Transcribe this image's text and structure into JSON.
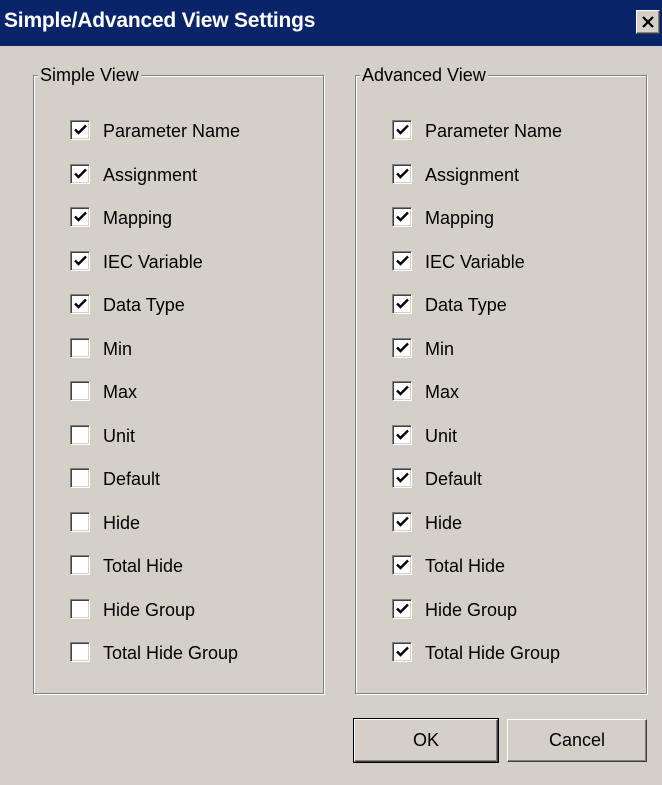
{
  "window": {
    "title": "Simple/Advanced View Settings",
    "close_icon": "close-x-icon"
  },
  "simple_view": {
    "legend": "Simple View",
    "items": [
      {
        "label": "Parameter Name",
        "checked": true
      },
      {
        "label": "Assignment",
        "checked": true
      },
      {
        "label": "Mapping",
        "checked": true
      },
      {
        "label": "IEC Variable",
        "checked": true
      },
      {
        "label": "Data Type",
        "checked": true
      },
      {
        "label": "Min",
        "checked": false
      },
      {
        "label": "Max",
        "checked": false
      },
      {
        "label": "Unit",
        "checked": false
      },
      {
        "label": "Default",
        "checked": false
      },
      {
        "label": "Hide",
        "checked": false
      },
      {
        "label": "Total Hide",
        "checked": false
      },
      {
        "label": "Hide Group",
        "checked": false
      },
      {
        "label": "Total Hide Group",
        "checked": false
      }
    ]
  },
  "advanced_view": {
    "legend": "Advanced View",
    "items": [
      {
        "label": "Parameter Name",
        "checked": true
      },
      {
        "label": "Assignment",
        "checked": true
      },
      {
        "label": "Mapping",
        "checked": true
      },
      {
        "label": "IEC Variable",
        "checked": true
      },
      {
        "label": "Data Type",
        "checked": true
      },
      {
        "label": "Min",
        "checked": true
      },
      {
        "label": "Max",
        "checked": true
      },
      {
        "label": "Unit",
        "checked": true
      },
      {
        "label": "Default",
        "checked": true
      },
      {
        "label": "Hide",
        "checked": true
      },
      {
        "label": "Total Hide",
        "checked": true
      },
      {
        "label": "Hide Group",
        "checked": true
      },
      {
        "label": "Total Hide Group",
        "checked": true
      }
    ]
  },
  "buttons": {
    "ok_label": "OK",
    "cancel_label": "Cancel"
  },
  "colors": {
    "titlebar": "#0a246a",
    "dialog_face": "#d4d0c8"
  }
}
